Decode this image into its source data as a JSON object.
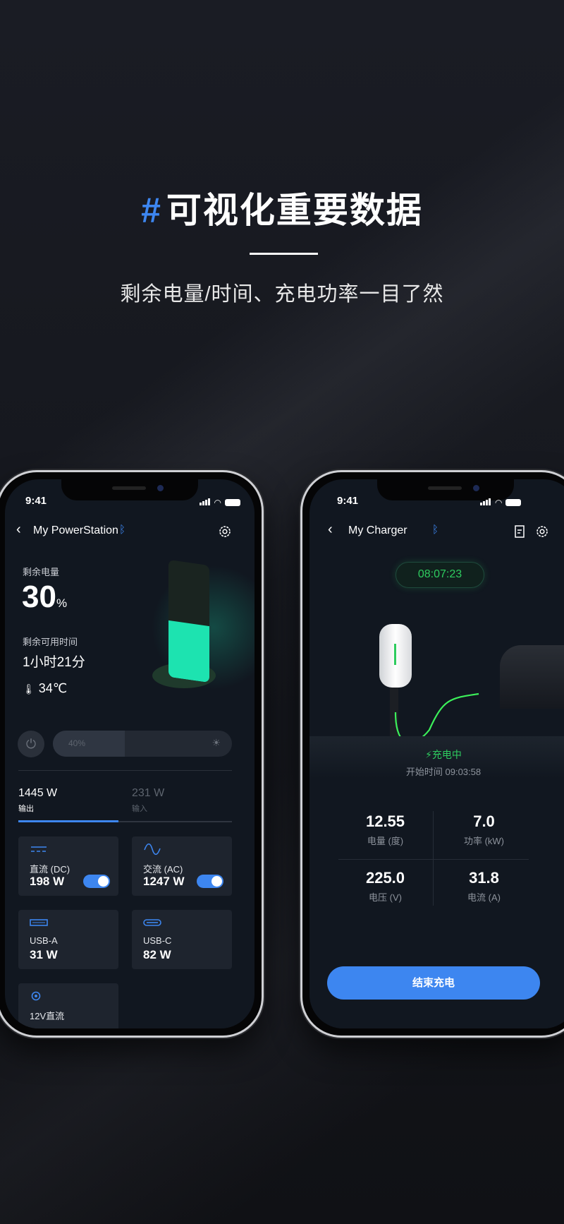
{
  "hero": {
    "hash": "#",
    "title": "可视化重要数据",
    "subtitle": "剩余电量/时间、充电功率一目了然"
  },
  "colors": {
    "accent": "#3d86f0",
    "green": "#2ecc5f",
    "battery": "#1de3b0",
    "bg": "#111720"
  },
  "power_station": {
    "status_time": "9:41",
    "title": "My PowerStation",
    "icons": [
      "back-icon",
      "bluetooth-icon",
      "gear-icon"
    ],
    "remaining_label": "剩余电量",
    "remaining_value": "30",
    "remaining_unit": "%",
    "battery_level": 0.3,
    "time_label": "剩余可用时间",
    "time_value": "1小时21分",
    "temperature": "34℃",
    "light_slider": {
      "label": "40%",
      "value": 0.4
    },
    "tabs": [
      {
        "value": "1445 W",
        "label": "输出",
        "active": true
      },
      {
        "value": "231 W",
        "label": "输入",
        "active": false
      }
    ],
    "outputs": [
      {
        "name": "直流 (DC)",
        "value": "198 W",
        "icon": "dc-icon",
        "toggle": true
      },
      {
        "name": "交流 (AC)",
        "value": "1247 W",
        "icon": "ac-wave-icon",
        "toggle": true
      },
      {
        "name": "USB-A",
        "value": "31 W",
        "icon": "usb-a-icon"
      },
      {
        "name": "USB-C",
        "value": "82 W",
        "icon": "usb-c-icon"
      },
      {
        "name": "12V直流",
        "icon": "dc-port-icon"
      }
    ]
  },
  "charger": {
    "status_time": "9:41",
    "title": "My Charger",
    "icons": [
      "back-icon",
      "bluetooth-icon",
      "document-icon",
      "gear-icon"
    ],
    "timer": "08:07:23",
    "status": "充电中",
    "start_time": "开始时间 09:03:58",
    "stats": [
      {
        "value": "12.55",
        "label": "电量 (度)"
      },
      {
        "value": "7.0",
        "label": "功率 (kW)"
      },
      {
        "value": "225.0",
        "label": "电压 (V)"
      },
      {
        "value": "31.8",
        "label": "电流 (A)"
      }
    ],
    "end_button": "结束充电"
  }
}
